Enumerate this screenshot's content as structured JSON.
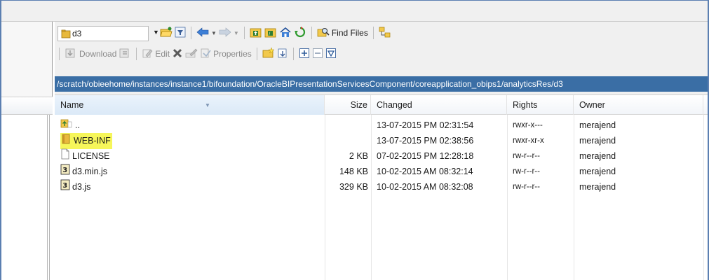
{
  "window": {
    "accent": "#3a6ea5",
    "highlight": "#f6f65a"
  },
  "toolbar1": {
    "location": "d3",
    "find_files_label": "Find Files",
    "icons": [
      "folder-open-icon",
      "filter-icon",
      "back-icon",
      "forward-icon",
      "parent-dir-icon",
      "root-dir-icon",
      "home-icon",
      "refresh-icon",
      "find-files-icon",
      "sync-browse-icon"
    ]
  },
  "toolbar2": {
    "download_label": "Download",
    "edit_label": "Edit",
    "properties_label": "Properties"
  },
  "path": "/scratch/obieehome/instances/instance1/bifoundation/OracleBIPresentationServicesComponent/coreapplication_obips1/analyticsRes/d3",
  "columns": {
    "name": "Name",
    "size": "Size",
    "changed": "Changed",
    "rights": "Rights",
    "owner": "Owner"
  },
  "files": [
    {
      "name": "..",
      "size": "",
      "changed": "13-07-2015 PM 02:31:54",
      "rights": "rwxr-x---",
      "owner": "merajend",
      "icon": "parent-folder-icon",
      "highlight": false
    },
    {
      "name": "WEB-INF",
      "size": "",
      "changed": "13-07-2015 PM 02:38:56",
      "rights": "rwxr-xr-x",
      "owner": "merajend",
      "icon": "folder-icon",
      "highlight": true
    },
    {
      "name": "LICENSE",
      "size": "2 KB",
      "changed": "07-02-2015 PM 12:28:18",
      "rights": "rw-r--r--",
      "owner": "merajend",
      "icon": "file-icon",
      "highlight": false
    },
    {
      "name": "d3.min.js",
      "size": "148 KB",
      "changed": "10-02-2015 AM 08:32:14",
      "rights": "rw-r--r--",
      "owner": "merajend",
      "icon": "script-file-icon",
      "highlight": false
    },
    {
      "name": "d3.js",
      "size": "329 KB",
      "changed": "10-02-2015 AM 08:32:08",
      "rights": "rw-r--r--",
      "owner": "merajend",
      "icon": "script-file-icon",
      "highlight": false
    }
  ]
}
